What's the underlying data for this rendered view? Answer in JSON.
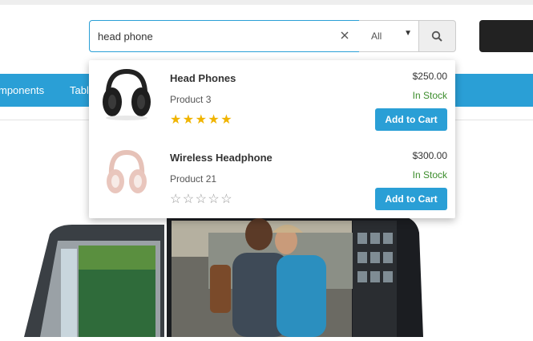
{
  "search": {
    "query": "head phone",
    "category": "All"
  },
  "nav": {
    "items": [
      "mponents",
      "Tabl"
    ]
  },
  "results": [
    {
      "name": "Head Phones",
      "subtitle": "Product 3",
      "price": "$250.00",
      "stock": "In Stock",
      "rating": 5,
      "rating_max": 5,
      "button": "Add to Cart"
    },
    {
      "name": "Wireless Headphone",
      "subtitle": "Product 21",
      "price": "$300.00",
      "stock": "In Stock",
      "rating": 0,
      "rating_max": 5,
      "button": "Add to Cart"
    }
  ],
  "colors": {
    "accent": "#2a9fd6",
    "stock": "#3c8d2c",
    "star": "#f0b400"
  },
  "icons": {
    "clear": "close-icon",
    "search": "search-icon",
    "caret": "caret-down-icon",
    "star": "star-icon"
  }
}
